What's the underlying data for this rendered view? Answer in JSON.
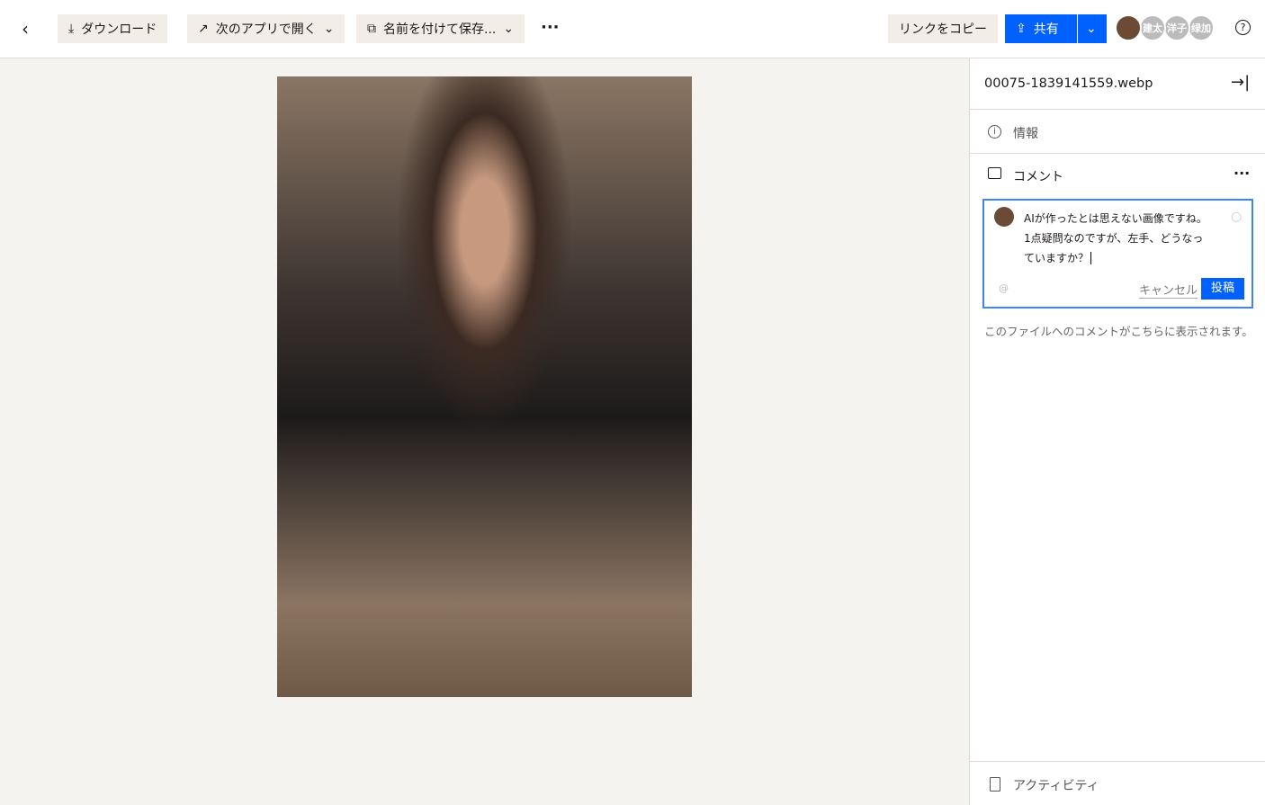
{
  "toolbar": {
    "download": "ダウンロード",
    "open_with": "次のアプリで開く",
    "save_as": "名前を付けて保存...",
    "copy_link": "リンクをコピー",
    "share": "共有",
    "avatars": [
      "建太",
      "洋子",
      "绿加"
    ]
  },
  "panel": {
    "filename": "00075-1839141559.webp",
    "info": "情報",
    "comments": "コメント",
    "comment_text": [
      "AIが作ったとは思えない画像ですね。",
      "1点疑問なのですが、左手、どうなっ",
      "ていますか？"
    ],
    "cancel": "キャンセル",
    "post": "投稿",
    "mention": "@",
    "empty_hint": "このファイルへのコメントがこちらに表示されます。",
    "activity": "アクティビティ"
  },
  "colors": {
    "accent": "#0061fe",
    "button_bg": "#f2ede6"
  }
}
